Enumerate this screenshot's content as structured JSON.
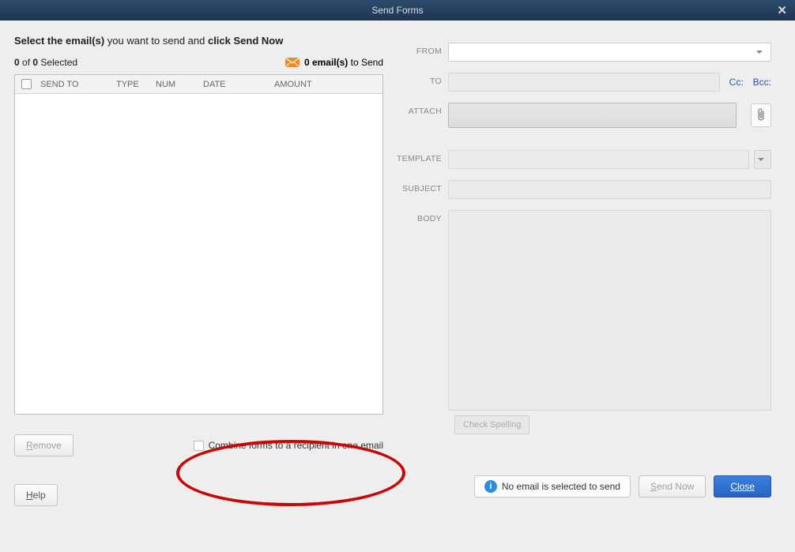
{
  "titlebar": {
    "title": "Send Forms"
  },
  "left": {
    "instruction_prefix_bold": "Select the email(s)",
    "instruction_mid": " you want to send and ",
    "instruction_suffix_bold": "click Send Now",
    "selected_count": "0",
    "selected_of": " of ",
    "selected_total": "0",
    "selected_suffix": " Selected",
    "tosend_bold": "0 email(s)",
    "tosend_suffix": " to Send",
    "columns": {
      "sendto": "SEND TO",
      "type": "TYPE",
      "num": "NUM",
      "date": "DATE",
      "amount": "AMOUNT"
    },
    "remove_label": "Remove",
    "combine_label": "Combine forms to a recipient in one email",
    "help_label": "Help"
  },
  "right": {
    "labels": {
      "from": "FROM",
      "to": "TO",
      "attach": "ATTACH",
      "template": "TEMPLATE",
      "subject": "SUBJECT",
      "body": "BODY"
    },
    "cc_link": "Cc:",
    "bcc_link": "Bcc:",
    "check_spelling": "Check Spelling",
    "info_msg": "No email is selected to send",
    "send_now": "Send Now",
    "close": "Close"
  }
}
